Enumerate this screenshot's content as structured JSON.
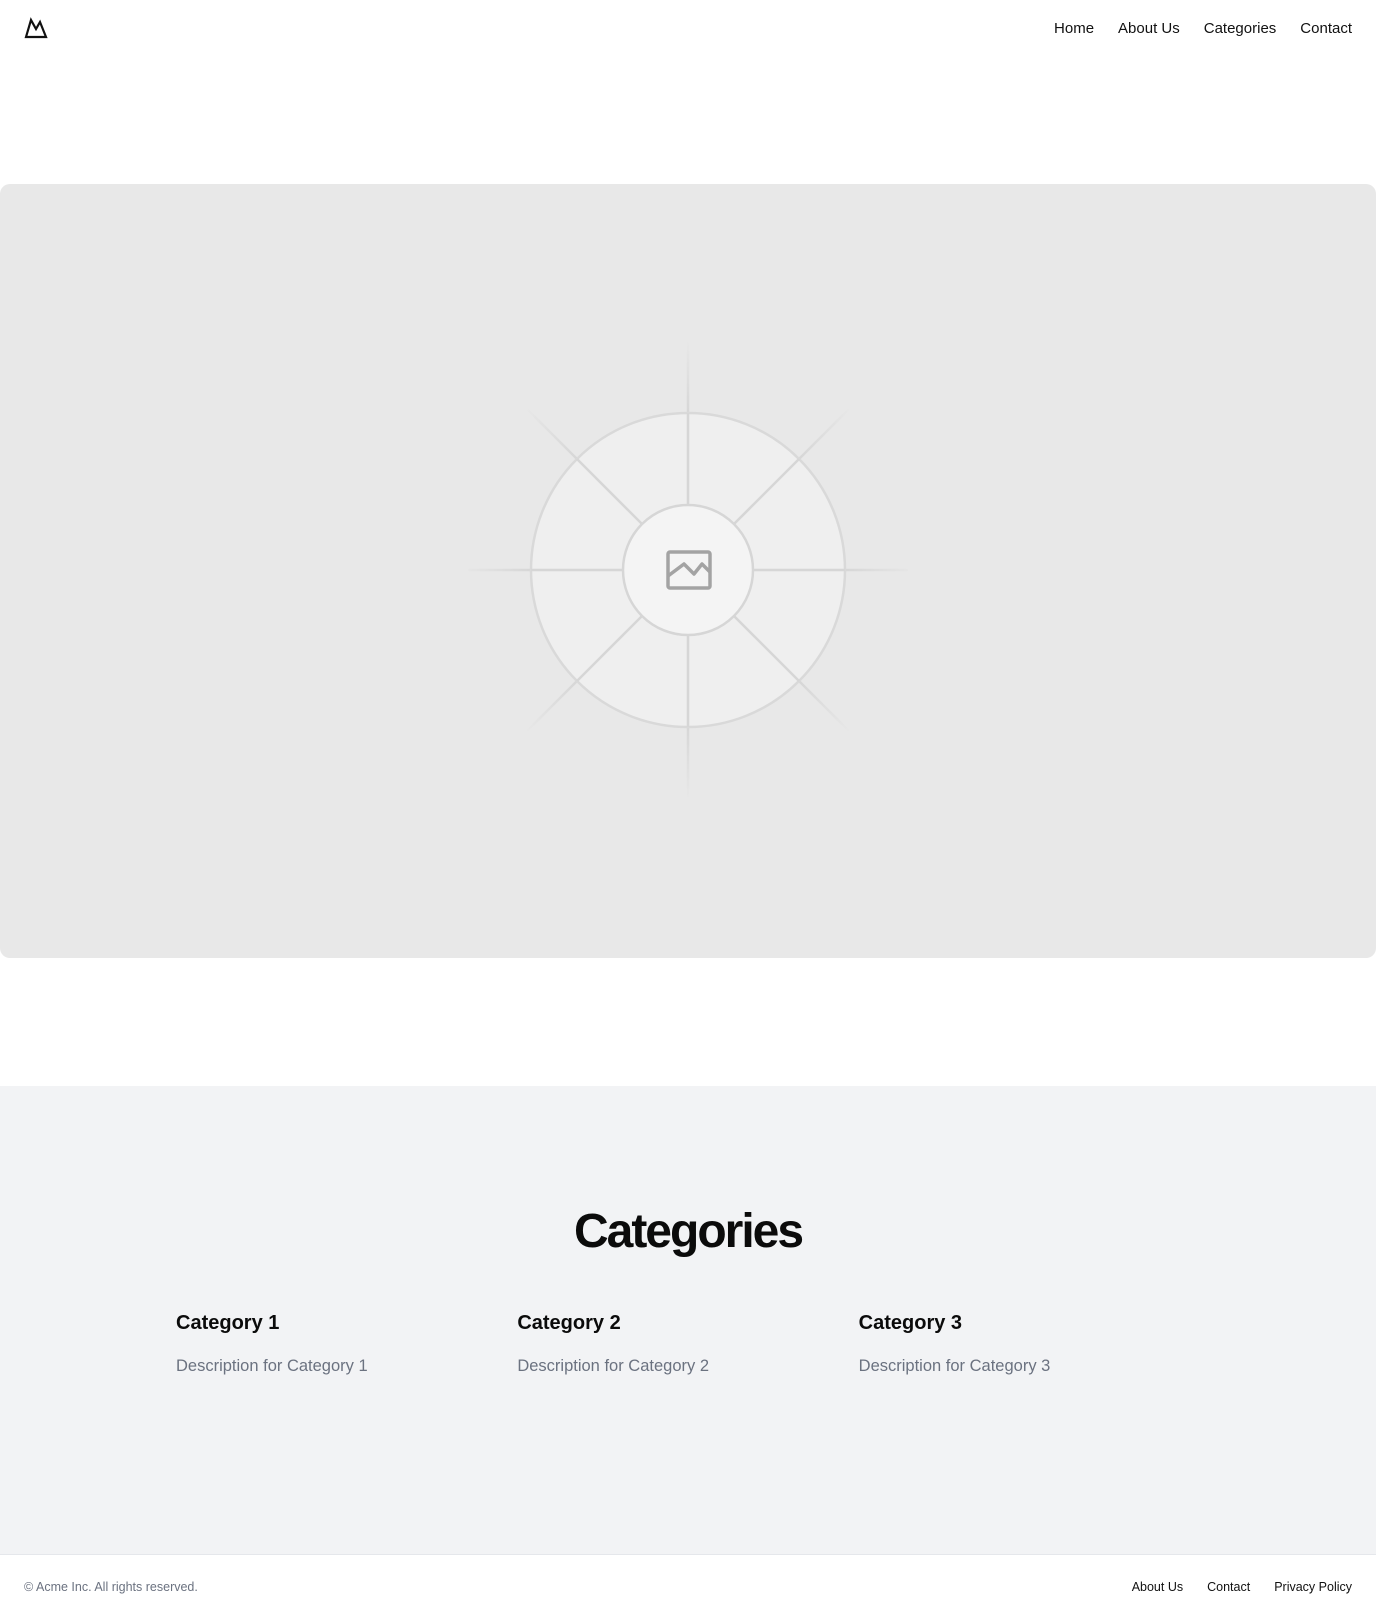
{
  "header": {
    "logo_icon": "mountain-icon",
    "nav": [
      {
        "label": "Home"
      },
      {
        "label": "About Us"
      },
      {
        "label": "Categories"
      },
      {
        "label": "Contact"
      }
    ]
  },
  "hero": {
    "image_icon": "image-placeholder-icon",
    "background_color": "#e8e8e8"
  },
  "categories": {
    "title": "Categories",
    "items": [
      {
        "title": "Category 1",
        "description": "Description for Category 1"
      },
      {
        "title": "Category 2",
        "description": "Description for Category 2"
      },
      {
        "title": "Category 3",
        "description": "Description for Category 3"
      }
    ],
    "background_color": "#f2f3f5"
  },
  "footer": {
    "copyright": "© Acme Inc. All rights reserved.",
    "links": [
      {
        "label": "About Us"
      },
      {
        "label": "Contact"
      },
      {
        "label": "Privacy Policy"
      }
    ]
  }
}
